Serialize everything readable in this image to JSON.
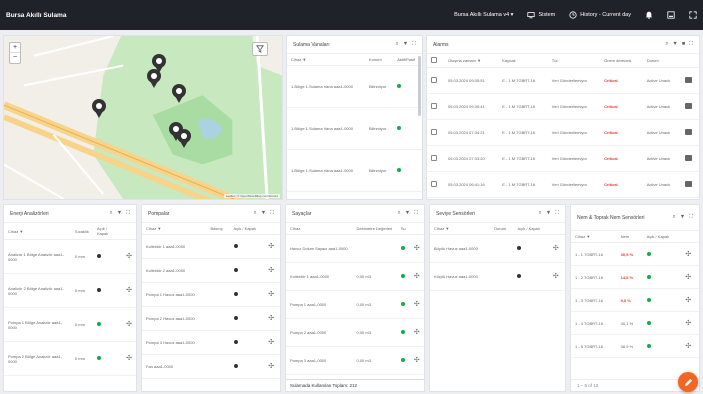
{
  "header": {
    "title": "Bursa Akıllı Sulama",
    "site_select": "Bursa Akıllı Sulama v4 ▾",
    "nav_edit": "Sistem",
    "history": "History - Current day"
  },
  "map": {
    "zoom_in": "+",
    "zoom_out": "−",
    "attribution": "Leaflet | © OpenStreetMap contributors"
  },
  "valves_panel": {
    "title": "Sulama Vanaları",
    "columns": [
      "Cihaz ▼",
      "Konum",
      "Aktif/Pasif"
    ],
    "rows": [
      {
        "name": "1.Bölge 1.Sulama Vana aaa1-0000",
        "loc": "Bilinmiyor"
      },
      {
        "name": "1.Bölge 1.Sulama Vana aaa1-0000",
        "loc": "Bilinmiyor"
      },
      {
        "name": "1.Bölge 1.Sulama Vana aaa1-0000",
        "loc": "Bilinmiyor"
      }
    ]
  },
  "alarms_panel": {
    "title": "Alarms",
    "columns": [
      "Oluşma zamanı ▼",
      "Kaynak",
      "Tür",
      "Önem derecesi",
      "Durum"
    ],
    "rows": [
      {
        "time": "05.03.2024 09:35:51",
        "src": "E - 1 M 7GBRT-16",
        "type": "Veri Gönderilemiyor",
        "sev": "Critical",
        "status": "Active Unack"
      },
      {
        "time": "05.03.2024 09:35:41",
        "src": "E - 1 M 7GBRT-16",
        "type": "Veri Gönderilemiyor",
        "sev": "Critical",
        "status": "Active Unack"
      },
      {
        "time": "05.03.2024 07:34:21",
        "src": "E - 1 M 7GBRT-16",
        "type": "Veri Gönderilemiyor",
        "sev": "Critical",
        "status": "Active Unack"
      },
      {
        "time": "05.03.2024 07:33:20",
        "src": "E - 1 M 7GBRT-16",
        "type": "Veri Gönderilemiyor",
        "sev": "Critical",
        "status": "Active Unack"
      },
      {
        "time": "05.03.2024 06:41:16",
        "src": "E - 1 M 7GBRT-16",
        "type": "Veri Gönderilemiyor",
        "sev": "Critical",
        "status": "Active Unack"
      }
    ]
  },
  "analyzers_panel": {
    "title": "Enerji Analizörleri",
    "columns": [
      "Cihaz ▼",
      "Sıcaklık",
      "Açık / Kapalı"
    ],
    "rows": [
      {
        "name": "Analizör 1 Bölge Analizör aaa1-0000",
        "temp": "0 mm",
        "dot": "dark"
      },
      {
        "name": "Analizör 2 Bölge Analizör aaa1-0000",
        "temp": "0 mm",
        "dot": "dark"
      },
      {
        "name": "Pompa 1 Bölge Analizör aaa1-0000",
        "temp": "0 mm",
        "dot": "green"
      },
      {
        "name": "Pompa 2 Bölge Analizör aaa1-0000",
        "temp": "0 mm",
        "dot": "green"
      }
    ]
  },
  "pumps_panel": {
    "title": "Pompalar",
    "columns": [
      "Cihaz ▼",
      "Basınç",
      "Açık / Kapalı"
    ],
    "rows": [
      {
        "name": "Kollektör 1 aaa1-0000"
      },
      {
        "name": "Kollektör 2 aaa1-0000"
      },
      {
        "name": "Pompa 1 Havuz aaa1-0000"
      },
      {
        "name": "Pompa 2 Havuz aaa1-0000"
      },
      {
        "name": "Pompa 3 Havuz aaa1-0000"
      },
      {
        "name": "Fan aaa1-0000"
      }
    ]
  },
  "meters_panel": {
    "title": "Sayaçlar",
    "columns": [
      "Cihaz",
      "Debimetre Değerleri",
      "Su"
    ],
    "rows": [
      {
        "name": "Havuz Dolum Sayacı aaa1-0000",
        "val": ""
      },
      {
        "name": "Kollektör 1 aaa1-0000",
        "val": "0,00 m3"
      },
      {
        "name": "Pompa 1 aaa1-0000",
        "val": "0,00 m3"
      },
      {
        "name": "Pompa 2 aaa1-0000",
        "val": "0,00 m3"
      },
      {
        "name": "Pompa 3 aaa1-0000",
        "val": "0,00 m3"
      }
    ],
    "footer": "Sulamada Kullanılan Toplam: 212"
  },
  "sensors_panel": {
    "title": "Seviye Sensörleri",
    "columns": [
      "Cihaz ▼",
      "Durum",
      "Açık / Kapalı"
    ],
    "rows": [
      {
        "name": "Büyük Havuz aaa1-0000"
      },
      {
        "name": "Küçük Havuz aaa1-0000"
      }
    ]
  },
  "humidity_panel": {
    "title": "Nem & Toprak Nem Sensörleri",
    "columns": [
      "Cihaz ▼",
      "Nem",
      "Açık / Kapalı"
    ],
    "rows": [
      {
        "name": "1 - 1 7GBRT-16",
        "val": "30,5 %"
      },
      {
        "name": "1 - 2 7GBRT-16",
        "val": "14,6 %"
      },
      {
        "name": "1 - 3 7GBRT-16",
        "val": "5,5 %"
      },
      {
        "name": "1 - 4 7GBRT-16",
        "val": "40,1 %"
      },
      {
        "name": "1 - 5 7GBRT-16",
        "val": "38,9 %"
      }
    ],
    "footer": "1 – 5 of 13"
  },
  "colors": {
    "accent": "#f26522",
    "critical": "#e53935",
    "active": "#1aa84a"
  }
}
